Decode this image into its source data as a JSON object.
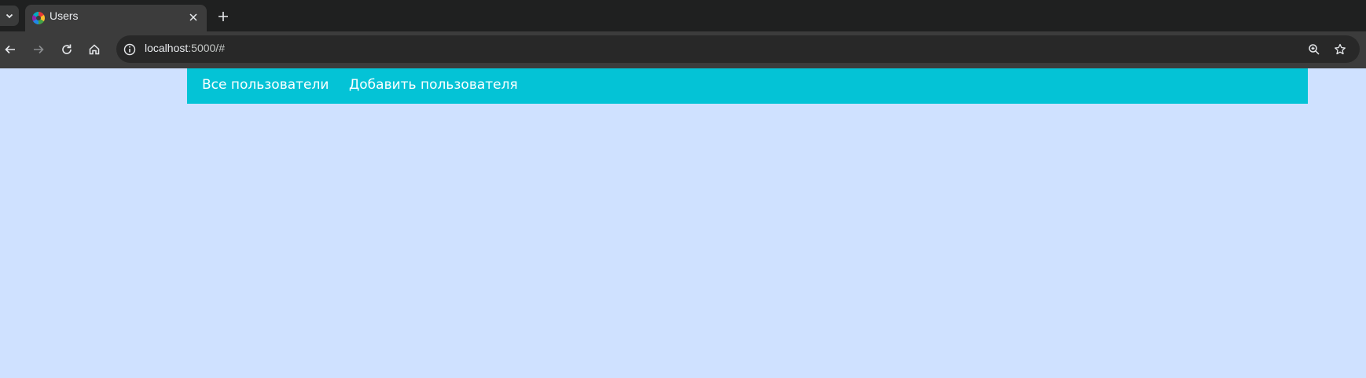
{
  "browser": {
    "tab": {
      "title": "Users",
      "favicon": "app-favicon"
    },
    "address_bar": {
      "host": "localhost",
      "rest": ":5000/#"
    },
    "icons": {
      "tab_list": "chevron-down-icon",
      "close_tab": "close-icon",
      "new_tab": "plus-icon",
      "back": "arrow-left-icon",
      "forward": "arrow-right-icon",
      "reload": "reload-icon",
      "home": "home-icon",
      "site_info": "info-icon",
      "zoom": "zoom-in-icon",
      "bookmark": "star-icon"
    }
  },
  "navbar": {
    "background": "#04c3d6",
    "items": [
      {
        "label": "Все пользователи"
      },
      {
        "label": "Добавить пользователя"
      }
    ]
  },
  "page": {
    "background": "#cfe1ff"
  }
}
